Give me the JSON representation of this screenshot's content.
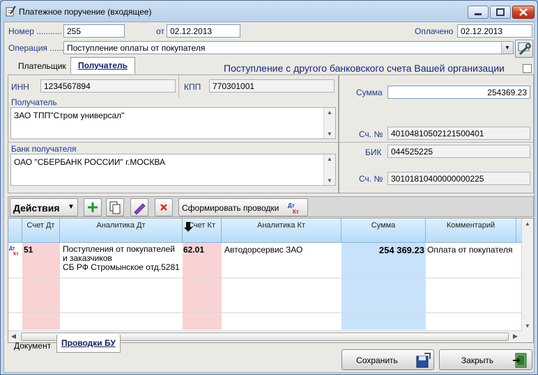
{
  "window": {
    "title": "Платежное поручение (входящее)"
  },
  "header": {
    "number_label": "Номер ...........",
    "number_value": "255",
    "date_label": "от",
    "date_value": "02.12.2013",
    "paid_label": "Оплачено",
    "paid_value": "02.12.2013",
    "operation_label": "Операция ......",
    "operation_value": "Поступление оплаты от покупателя"
  },
  "tabs": {
    "payer": "Плательщик",
    "recipient": "Получатель"
  },
  "own_account": {
    "label": "Поступление с другого банковского счета Вашей организации",
    "checked": false
  },
  "recipient": {
    "inn_label": "ИНН",
    "inn_value": "1234567894",
    "kpp_label": "КПП",
    "kpp_value": "770301001",
    "name_label": "Получатель",
    "name_value": "ЗАО ТПП\"Стром универсал\"",
    "bank_label": "Банк получателя",
    "bank_value": "ОАО \"СБЕРБАНК РОССИИ\" г.МОСКВА"
  },
  "right": {
    "sum_label": "Сумма",
    "sum_value": "254369.23",
    "acc_label": "Сч. №",
    "acc_value": "40104810502121500401",
    "bik_label": "БИК",
    "bik_value": "044525225",
    "corr_label": "Сч. №",
    "corr_value": "30101810400000000225"
  },
  "toolbar": {
    "actions": "Действия",
    "form_entries": "Сформировать проводки"
  },
  "grid": {
    "columns": [
      "Счет Дт",
      "Аналитика Дт",
      "Счет Кт",
      "Аналитика Кт",
      "Сумма",
      "Комментарий"
    ],
    "rows": [
      {
        "dt": "51",
        "an_dt_1": "Поступления от покупателей",
        "an_dt_2": "и заказчиков",
        "an_dt_3": "СБ РФ Стромынское отд.5281",
        "kt": "62.01",
        "an_kt": "Автодорсервис ЗАО",
        "sum": "254 369.23",
        "comment": "Оплата от покупателя"
      }
    ]
  },
  "bottom_tabs": {
    "document": "Документ",
    "entries": "Проводки БУ"
  },
  "buttons": {
    "save": "Сохранить",
    "close": "Закрыть"
  }
}
